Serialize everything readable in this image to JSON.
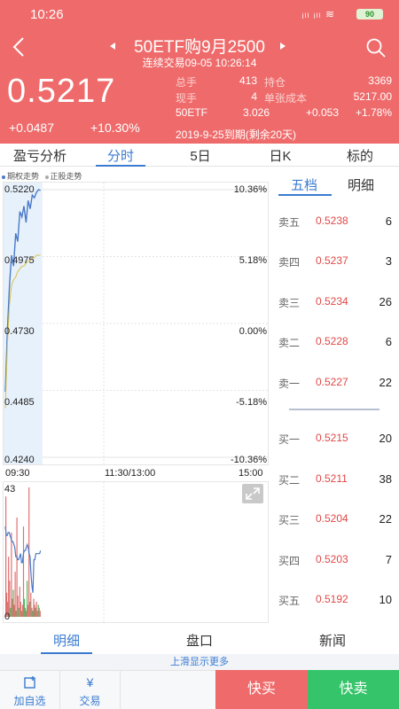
{
  "status": {
    "time": "10:26",
    "signal": "ᵢₗₗ ᵢₗₗ ≋",
    "battery": "90"
  },
  "header": {
    "title": "50ETF购9月2500",
    "subtitle": "连续交易09-05  10:26:14",
    "price": "0.5217",
    "change": "+0.0487",
    "change_pct": "+10.30%",
    "stats": {
      "total_hand_label": "总手",
      "total_hand": "413",
      "position_label": "持仓",
      "position": "3369",
      "current_hand_label": "现手",
      "current_hand": "4",
      "unit_cost_label": "单张成本",
      "unit_cost": "5217.00",
      "underlying_name": "50ETF",
      "underlying_price": "3.026",
      "underlying_change": "+0.053",
      "underlying_pct": "+1.78%"
    },
    "expiry": "2019-9-25到期(剩余20天)"
  },
  "tabs": [
    "盈亏分析",
    "分时",
    "5日",
    "日K",
    "标的"
  ],
  "legend": {
    "option": "期权走势",
    "underlying": "正股走势"
  },
  "chart_data": {
    "type": "line",
    "y_left_ticks": [
      "0.5220",
      "0.4975",
      "0.4730",
      "0.4485",
      "0.4240"
    ],
    "y_right_ticks": [
      "10.36%",
      "5.18%",
      "0.00%",
      "-5.18%",
      "-10.36%"
    ],
    "x_ticks": [
      "09:30",
      "11:30/13:00",
      "15:00"
    ],
    "ylim": [
      0.424,
      0.522
    ],
    "series": [
      {
        "values": [
          0.448,
          0.47,
          0.487,
          0.498,
          0.494,
          0.506,
          0.503,
          0.514,
          0.512,
          0.516,
          0.51,
          0.518,
          0.515,
          0.52,
          0.519,
          0.521,
          0.522,
          0.5217
        ],
        "color": "#4b79c8"
      },
      {
        "values": [
          0.442,
          0.465,
          0.48,
          0.487,
          0.489,
          0.49,
          0.492,
          0.493,
          0.494,
          0.494,
          0.495,
          0.496,
          0.496,
          0.497,
          0.497,
          0.498,
          0.498,
          0.498
        ],
        "color": "#d9c24a"
      }
    ],
    "volume": {
      "max_label": "43",
      "min_label": "0",
      "ylim": [
        0,
        43
      ],
      "bars": [
        40,
        8,
        5,
        20,
        12,
        3,
        28,
        6,
        9,
        4,
        15,
        2,
        33,
        7,
        3,
        10,
        5,
        2,
        4,
        30,
        6,
        3,
        2,
        12,
        4,
        43,
        5,
        8,
        3,
        2,
        6,
        4,
        3,
        5,
        2,
        4,
        3,
        2
      ],
      "bar_colors": [
        "#e07070",
        "#4cb860"
      ],
      "position_line": [
        30,
        27,
        27,
        28,
        28,
        27,
        26,
        25,
        25,
        24,
        23,
        20,
        20,
        19,
        19,
        20,
        21,
        18,
        18,
        21,
        22,
        22,
        23,
        24,
        23,
        21,
        20,
        14,
        10,
        8,
        19,
        19,
        21,
        21,
        21,
        21,
        21,
        22
      ],
      "position_color": "#4b79c8"
    }
  },
  "orderbook": {
    "tabs": [
      "五档",
      "明细"
    ],
    "asks": [
      {
        "label": "卖五",
        "price": "0.5238",
        "qty": "6"
      },
      {
        "label": "卖四",
        "price": "0.5237",
        "qty": "3"
      },
      {
        "label": "卖三",
        "price": "0.5234",
        "qty": "26"
      },
      {
        "label": "卖二",
        "price": "0.5228",
        "qty": "6"
      },
      {
        "label": "卖一",
        "price": "0.5227",
        "qty": "22"
      }
    ],
    "bids": [
      {
        "label": "买一",
        "price": "0.5215",
        "qty": "20"
      },
      {
        "label": "买二",
        "price": "0.5211",
        "qty": "38"
      },
      {
        "label": "买三",
        "price": "0.5204",
        "qty": "22"
      },
      {
        "label": "买四",
        "price": "0.5203",
        "qty": "7"
      },
      {
        "label": "买五",
        "price": "0.5192",
        "qty": "10"
      }
    ]
  },
  "bottom_tabs": [
    "明细",
    "盘口",
    "新闻"
  ],
  "more_hint": "上滑显示更多",
  "actions": {
    "watchlist": "加自选",
    "trade": "交易",
    "trade_icon": "¥",
    "quick_buy": "快买",
    "quick_sell": "快卖"
  },
  "colors": {
    "header_bg": "#ef6b6b",
    "accent": "#3b7bd0",
    "sell": "#36c46a"
  }
}
